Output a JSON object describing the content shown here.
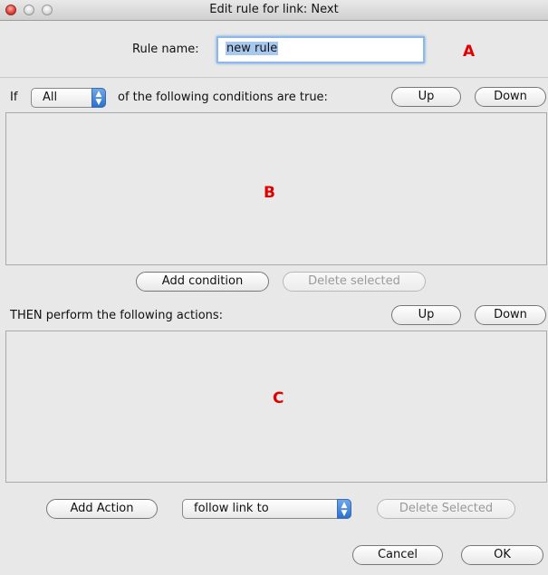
{
  "window": {
    "title": "Edit rule for link: Next"
  },
  "rule": {
    "name_label": "Rule name:",
    "name_value": "new rule",
    "marker_a": "A"
  },
  "conditions": {
    "if_label": "If",
    "match_select": "All",
    "suffix_label": "of the following conditions are true:",
    "up_label": "Up",
    "down_label": "Down",
    "marker_b": "B",
    "add_label": "Add condition",
    "delete_label": "Delete selected"
  },
  "actions": {
    "then_label": "THEN perform the following actions:",
    "up_label": "Up",
    "down_label": "Down",
    "marker_c": "C",
    "add_label": "Add Action",
    "type_select": "follow link to",
    "delete_label": "Delete Selected"
  },
  "footer": {
    "cancel_label": "Cancel",
    "ok_label": "OK"
  }
}
